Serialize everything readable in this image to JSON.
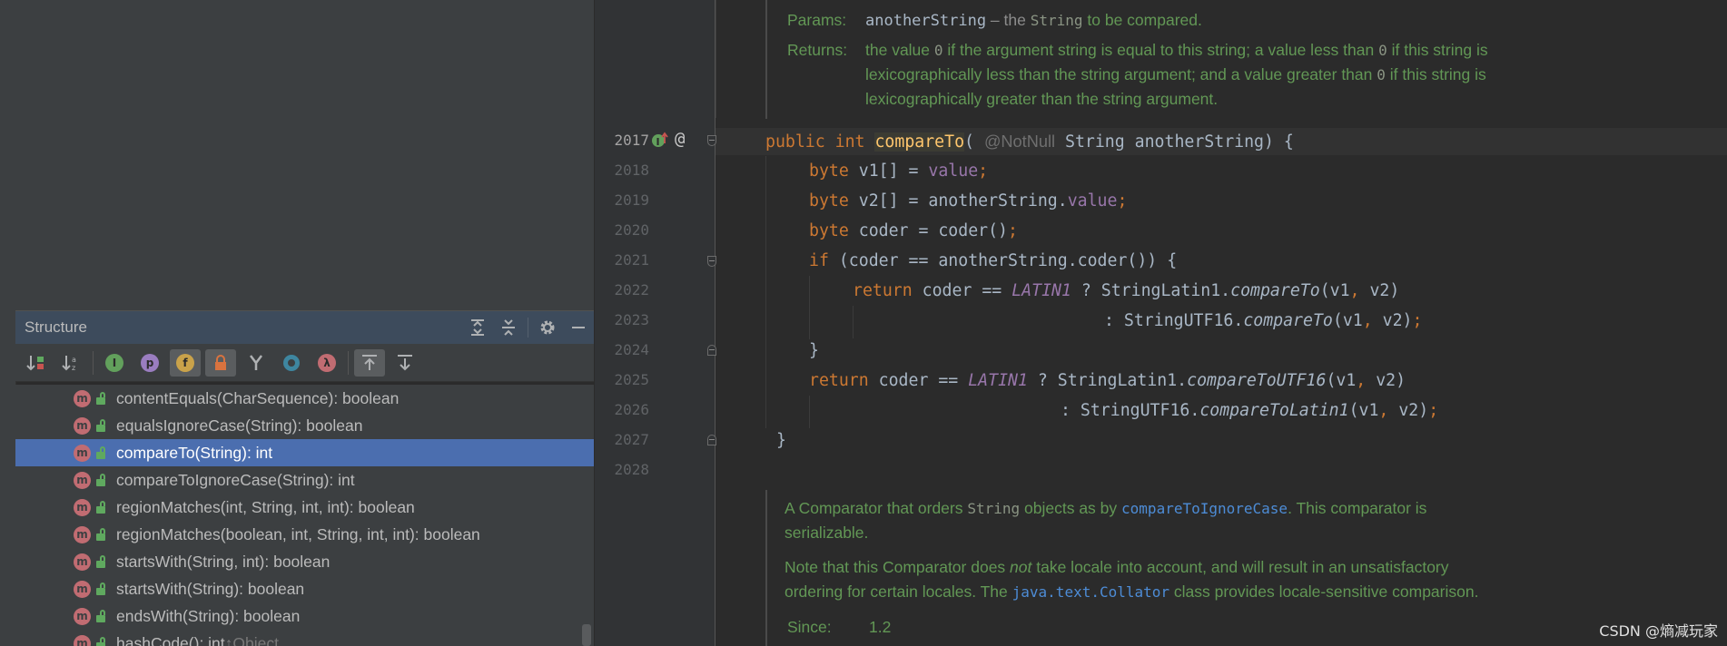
{
  "structure": {
    "title": "Structure",
    "toolbar": {
      "sort_visibility": "sort-by-visibility",
      "sort_alpha": "sort-alphabetically",
      "inherited_label": "I",
      "properties_label": "p",
      "fields_label": "f",
      "lambdas_label": "λ"
    },
    "items": [
      {
        "name": "contentEquals(CharSequence): boolean",
        "hint": ""
      },
      {
        "name": "equalsIgnoreCase(String): boolean",
        "hint": ""
      },
      {
        "name": "compareTo(String): int",
        "hint": ""
      },
      {
        "name": "compareToIgnoreCase(String): int",
        "hint": ""
      },
      {
        "name": "regionMatches(int, String, int, int): boolean",
        "hint": ""
      },
      {
        "name": "regionMatches(boolean, int, String, int, int): boolean",
        "hint": ""
      },
      {
        "name": "startsWith(String, int): boolean",
        "hint": ""
      },
      {
        "name": "startsWith(String): boolean",
        "hint": ""
      },
      {
        "name": "endsWith(String): boolean",
        "hint": ""
      },
      {
        "name": "hashCode(): int",
        "hint": "↑Object"
      }
    ],
    "method_badge": "m"
  },
  "editor": {
    "doc_top": {
      "params_label": "Params:",
      "params_name": "anotherString",
      "params_text_a": " – the ",
      "params_code": "String",
      "params_text_b": " to be compared.",
      "returns_label": "Returns:",
      "returns_l1a": "the value ",
      "returns_zero1": "0",
      "returns_l1b": " if the argument string is equal to this string; a value less than ",
      "returns_zero2": "0",
      "returns_l1c": " if this string is",
      "returns_l2a": "lexicographically less than the string argument; and a value greater than ",
      "returns_zero3": "0",
      "returns_l2b": " if this string is",
      "returns_l3": "lexicographically greater than the string argument."
    },
    "line_numbers": [
      "2017",
      "2018",
      "2019",
      "2020",
      "2021",
      "2022",
      "2023",
      "2024",
      "2025",
      "2026",
      "2027",
      "2028"
    ],
    "code": {
      "l1": {
        "kw1": "public ",
        "kw2": "int ",
        "fn": "compareTo",
        "p1": "( ",
        "ann": "@NotNull",
        "p2": " String anotherString) {"
      },
      "l2": {
        "kw": "byte ",
        "a": "v1[] = ",
        "fld": "value",
        "semi": ";"
      },
      "l3": {
        "kw": "byte ",
        "a": "v2[] = anotherString.",
        "fld": "value",
        "semi": ";"
      },
      "l4": {
        "kw": "byte ",
        "a": "coder = coder()",
        "semi": ";"
      },
      "l5": {
        "kw": "if ",
        "a": "(coder == anotherString.coder()) {"
      },
      "l6": {
        "kw": "return ",
        "a": "coder == ",
        "cst": "LATIN1",
        "b": " ? StringLatin1.",
        "fn": "compareTo",
        "c": "(v1",
        "comma": ",",
        "d": " v2)"
      },
      "l7": {
        "a": ": StringUTF16.",
        "fn": "compareTo",
        "c": "(v1",
        "comma": ",",
        "d": " v2)",
        "semi": ";"
      },
      "l8": {
        "a": "}"
      },
      "l9": {
        "kw": "return ",
        "a": "coder == ",
        "cst": "LATIN1",
        "b": " ? StringLatin1.",
        "fn": "compareToUTF16",
        "c": "(v1",
        "comma": ",",
        "d": " v2)"
      },
      "l10": {
        "a": ": StringUTF16.",
        "fn": "compareToLatin1",
        "c": "(v1",
        "comma": ",",
        "d": " v2)",
        "semi": ";"
      },
      "l11": {
        "a": "}"
      }
    },
    "doc_bottom": {
      "p1a": "A Comparator that orders ",
      "p1code": "String",
      "p1b": " objects as by ",
      "p1link": "compareToIgnoreCase",
      "p1c": ". This comparator is",
      "p1d": "serializable.",
      "p2a": "Note that this Comparator does ",
      "p2em": "not",
      "p2b": " take locale into account, and will result in an unsatisfactory",
      "p2c": "ordering for certain locales. The ",
      "p2link": "java.text.Collator",
      "p2d": " class provides locale-sensitive comparison.",
      "since_label": "Since:",
      "since_value": "1.2"
    },
    "gutter_icons": [
      "override-icon",
      "annotation-icon"
    ],
    "gutter_at": "@"
  },
  "watermark": "CSDN @熵减玩家"
}
